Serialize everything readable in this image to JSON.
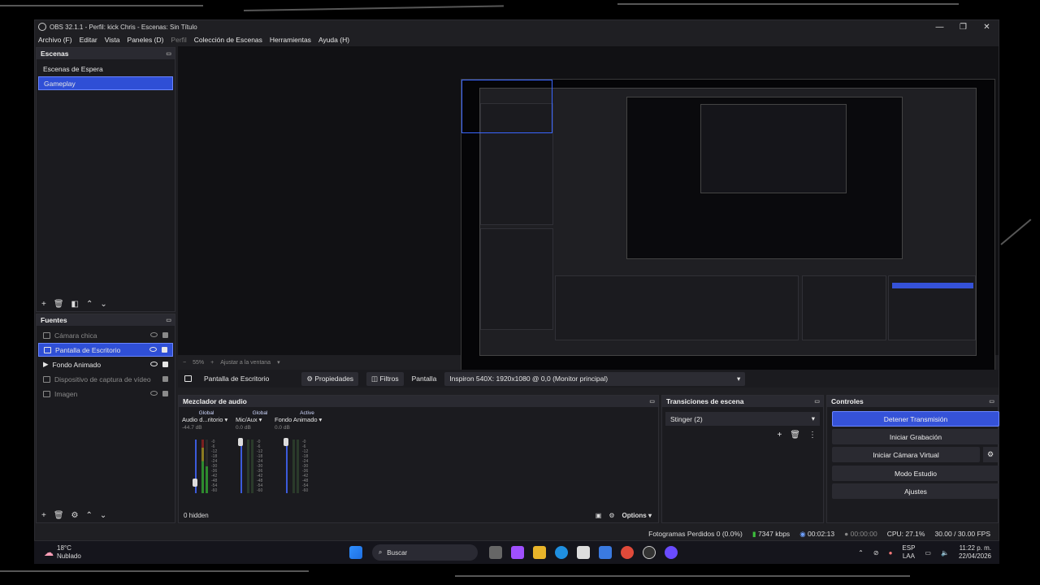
{
  "window": {
    "title": "OBS 32.1.1 - Perfil: kick Chris - Escenas: Sin Título",
    "controls": {
      "minimize": "—",
      "maximize": "❐",
      "close": "✕"
    }
  },
  "menu": {
    "archivo": "Archivo (F)",
    "editar": "Editar",
    "vista": "Vista",
    "paneles": "Paneles (D)",
    "perfil": "Perfil",
    "coleccion": "Colección de Escenas",
    "herramientas": "Herramientas",
    "ayuda": "Ayuda (H)"
  },
  "scenes": {
    "title": "Escenas",
    "items": [
      {
        "label": "Escenas de Espera"
      },
      {
        "label": "Gameplay"
      }
    ]
  },
  "sources": {
    "title": "Fuentes",
    "items": [
      {
        "label": "Cámara chica"
      },
      {
        "label": "Pantalla de Escritorio"
      },
      {
        "label": "Fondo Animado"
      },
      {
        "label": "Dispositivo de captura de vídeo"
      },
      {
        "label": "Imagen"
      }
    ]
  },
  "zoom": {
    "value": "55%",
    "fit": "Ajustar a la ventana"
  },
  "properties_bar": {
    "source_name": "Pantalla de Escritorio",
    "properties": "Propiedades",
    "filters": "Filtros",
    "display_label": "Pantalla",
    "display_value": "Inspiron 540X: 1920x1080 @ 0,0 (Monitor principal)"
  },
  "mixer": {
    "title": "Mezclador de audio",
    "channels": [
      {
        "tag": "Global",
        "name": "Audio d...ritorio",
        "db": "-44.7 dB"
      },
      {
        "tag": "Global",
        "name": "Mic/Aux",
        "db": "0.0 dB"
      },
      {
        "tag": "Active",
        "name": "Fondo Animado",
        "db": "0.0 dB"
      }
    ],
    "scale": [
      "-0",
      "-6",
      "-12",
      "-18",
      "-24",
      "-30",
      "-36",
      "-42",
      "-48",
      "-54",
      "-60"
    ],
    "hidden": "0 hidden",
    "options": "Options"
  },
  "transitions": {
    "title": "Transiciones de escena",
    "selected": "Stinger (2)"
  },
  "controls": {
    "title": "Controles",
    "stop_stream": "Detener Transmisión",
    "start_record": "Iniciar Grabación",
    "start_vcam": "Iniciar Cámara Virtual",
    "studio_mode": "Modo Estudio",
    "settings": "Ajustes"
  },
  "status": {
    "dropped": "Fotogramas Perdidos 0 (0.0%)",
    "bitrate": "7347 kbps",
    "stream_time": "00:02:13",
    "record_time": "00:00:00",
    "cpu": "CPU: 27.1%",
    "fps": "30.00 / 30.00 FPS"
  },
  "taskbar": {
    "weather_temp": "18°C",
    "weather_desc": "Nublado",
    "search": "Buscar",
    "lang_top": "ESP",
    "lang_bottom": "LAA",
    "time": "11:22 p. m.",
    "date": "22/04/2026"
  },
  "colors": {
    "accent": "#3552d8",
    "panel": "#1b1b1f",
    "window": "#1f1f23"
  }
}
